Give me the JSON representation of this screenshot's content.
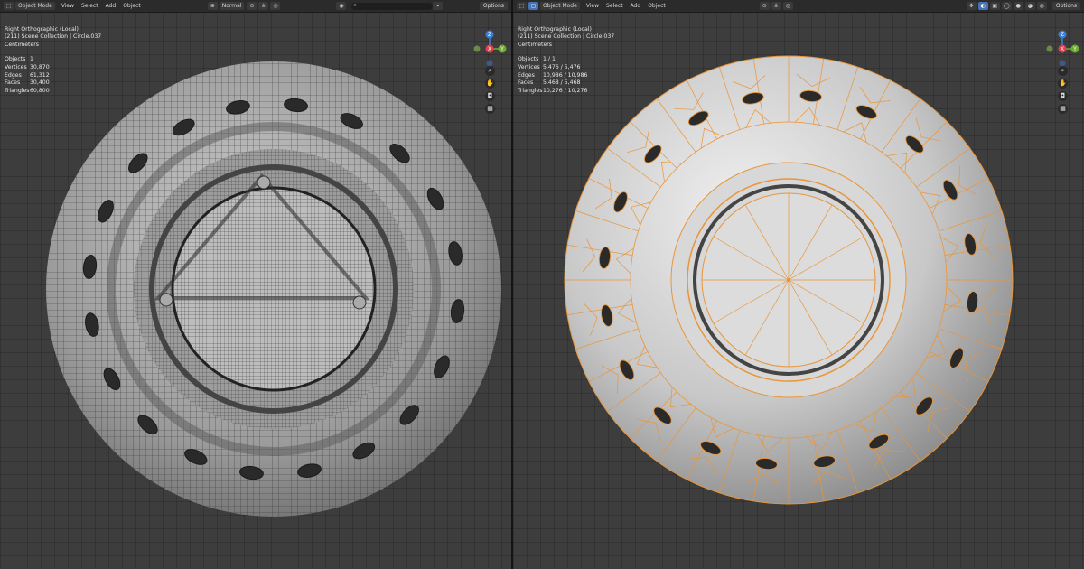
{
  "left": {
    "header": {
      "mode": "Object Mode",
      "menus": [
        "View",
        "Select",
        "Add",
        "Object"
      ],
      "shading": "Normal",
      "options": "Options"
    },
    "overlay": {
      "view_name": "Right Orthographic (Local)",
      "collection": "(211) Scene Collection | Circle.037",
      "units": "Centimeters"
    },
    "stats": [
      {
        "label": "Objects",
        "value": "1"
      },
      {
        "label": "Vertices",
        "value": "30,870"
      },
      {
        "label": "Edges",
        "value": "61,312"
      },
      {
        "label": "Faces",
        "value": "30,400"
      },
      {
        "label": "Triangles",
        "value": "60,800"
      }
    ]
  },
  "right": {
    "header": {
      "mode": "Object Mode",
      "menus": [
        "View",
        "Select",
        "Add",
        "Object"
      ],
      "options": "Options"
    },
    "overlay": {
      "view_name": "Right Orthographic (Local)",
      "collection": "(211) Scene Collection | Circle.037",
      "units": "Centimeters"
    },
    "stats": [
      {
        "label": "Objects",
        "value": "1 / 1"
      },
      {
        "label": "Vertices",
        "value": "5,476 / 5,476"
      },
      {
        "label": "Edges",
        "value": "10,986 / 10,986"
      },
      {
        "label": "Faces",
        "value": "5,468 / 5,468"
      },
      {
        "label": "Triangles",
        "value": "10,276 / 10,276"
      }
    ]
  },
  "gizmo": {
    "z": "Z",
    "x": "X",
    "y": "Y"
  },
  "colors": {
    "viewport_bg": "#3d3d3d",
    "header_bg": "#2b2b2b",
    "selection_orange": "#e8953a",
    "axis_x": "#e04050",
    "axis_y": "#6cad2e",
    "axis_z": "#3d7fd8",
    "active_blue": "#4772b3"
  },
  "icons": [
    "editor-type-icon",
    "select-box-icon",
    "visibility-icon",
    "gizmo-icon",
    "overlay-icon",
    "xray-icon",
    "shading-solid-icon",
    "zoom-icon",
    "hand-pan-icon",
    "camera-icon",
    "grid-icon",
    "search-icon",
    "filter-icon"
  ]
}
